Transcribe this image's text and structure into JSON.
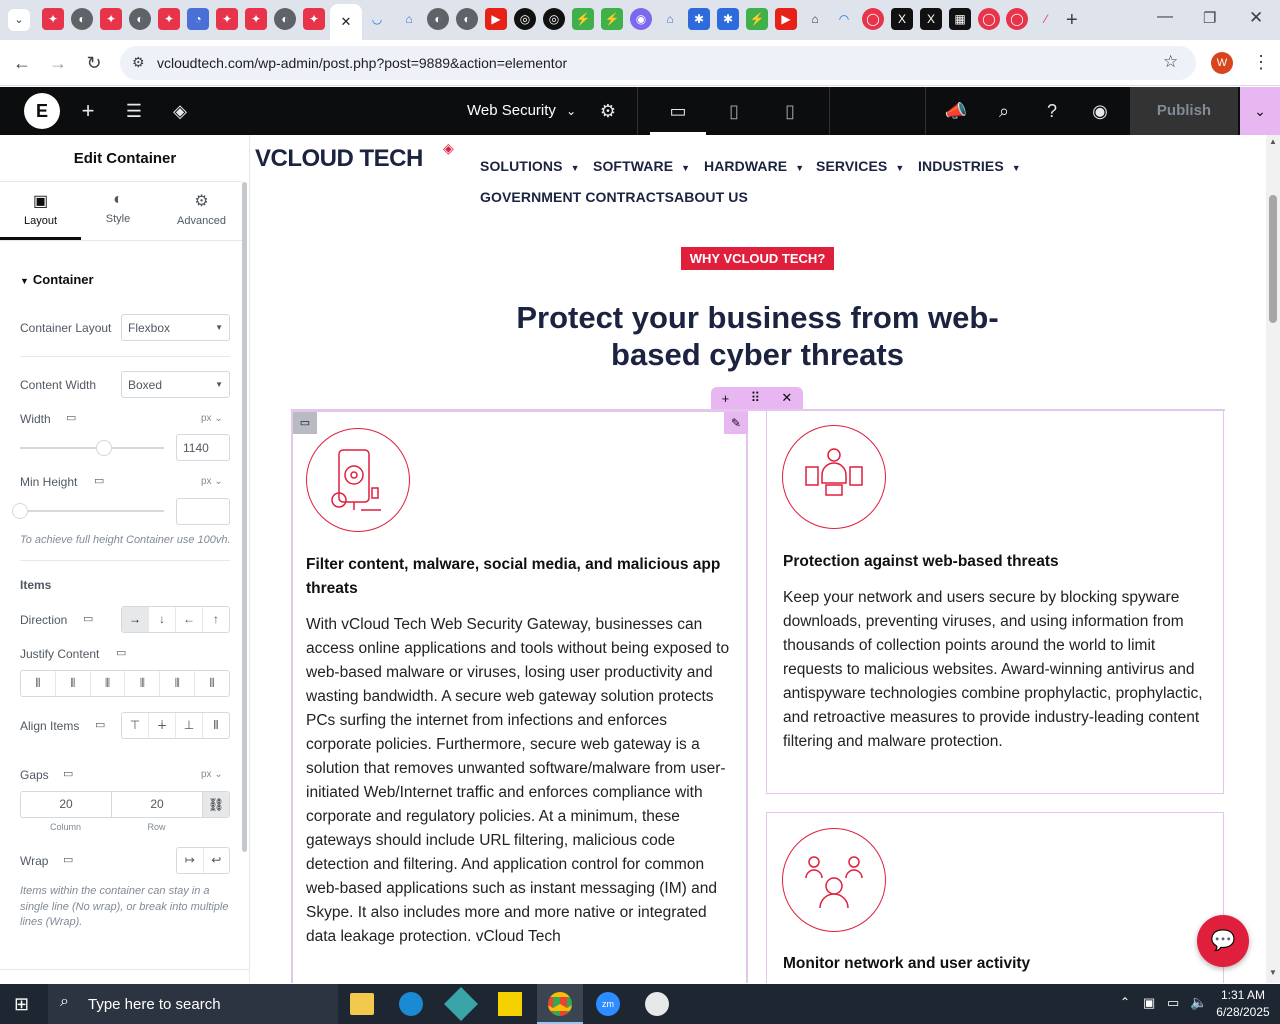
{
  "browser": {
    "url": "vcloudtech.com/wp-admin/post.php?post=9889&action=elementor",
    "profile_initial": "W"
  },
  "elementor_bar": {
    "page_name": "Web Security",
    "publish_label": "Publish"
  },
  "panel": {
    "title": "Edit Container",
    "tabs": [
      {
        "label": "Layout"
      },
      {
        "label": "Style"
      },
      {
        "label": "Advanced"
      }
    ],
    "section_title": "Container",
    "container_layout": {
      "label": "Container Layout",
      "value": "Flexbox"
    },
    "content_width": {
      "label": "Content Width",
      "value": "Boxed"
    },
    "width": {
      "label": "Width",
      "unit": "px",
      "value": "1140"
    },
    "min_height": {
      "label": "Min Height",
      "unit": "px",
      "value": ""
    },
    "min_height_note": "To achieve full height Container use 100vh.",
    "items_heading": "Items",
    "direction_label": "Direction",
    "justify_label": "Justify Content",
    "align_label": "Align Items",
    "gaps": {
      "label": "Gaps",
      "unit": "px",
      "column": "20",
      "row": "20",
      "column_label": "Column",
      "row_label": "Row"
    },
    "wrap_label": "Wrap",
    "wrap_note": "Items within the container can stay in a single line (No wrap), or break into multiple lines (Wrap)."
  },
  "site": {
    "logo_text": "VCLOUD TECH",
    "nav": [
      {
        "label": "SOLUTIONS",
        "dropdown": true
      },
      {
        "label": "SOFTWARE",
        "dropdown": true
      },
      {
        "label": "HARDWARE",
        "dropdown": true
      },
      {
        "label": "SERVICES",
        "dropdown": true
      },
      {
        "label": "INDUSTRIES",
        "dropdown": true
      },
      {
        "label": "GOVERNMENT CONTRACTS",
        "dropdown": false
      },
      {
        "label": "ABOUT US",
        "dropdown": false
      }
    ],
    "badge": "WHY VCLOUD TECH?",
    "headline_line1": "Protect your business from web-",
    "headline_line2": "based cyber threats",
    "cards": [
      {
        "title": "Filter content, malware, social media, and malicious app threats",
        "text": "With vCloud Tech Web Security Gateway, businesses can access online applications and tools without being exposed to web-based malware or viruses, losing user productivity and wasting bandwidth. A secure web gateway solution protects PCs surfing the internet from infections and enforces corporate policies. Furthermore, secure web gateway is a solution that removes unwanted software/malware from user-initiated Web/Internet traffic and enforces compliance with corporate and regulatory policies. At a minimum, these gateways should include URL filtering, malicious code detection and filtering. And application control for common web-based applications such as instant messaging (IM) and Skype. It also includes more and more native or integrated data leakage protection. vCloud Tech"
      },
      {
        "title": "Protection against web-based threats",
        "text": "Keep your network and users secure by blocking spyware downloads, preventing viruses, and using information from thousands of collection points around the world to limit requests to malicious websites. Award-winning antivirus and antispyware technologies combine prophylactic, prophylactic, and retroactive measures to provide industry-leading content filtering and malware protection."
      },
      {
        "title": "Monitor network and user activity",
        "text": ""
      }
    ]
  },
  "taskbar": {
    "search_placeholder": "Type here to search",
    "time": "1:31 AM",
    "date": "6/28/2025"
  },
  "colors": {
    "accent_red": "#e01f3d",
    "navy": "#1b2340",
    "elementor_pink": "#e3c6ec",
    "publish_bg": "#333",
    "dropdown_pink": "#e8b7f2"
  }
}
